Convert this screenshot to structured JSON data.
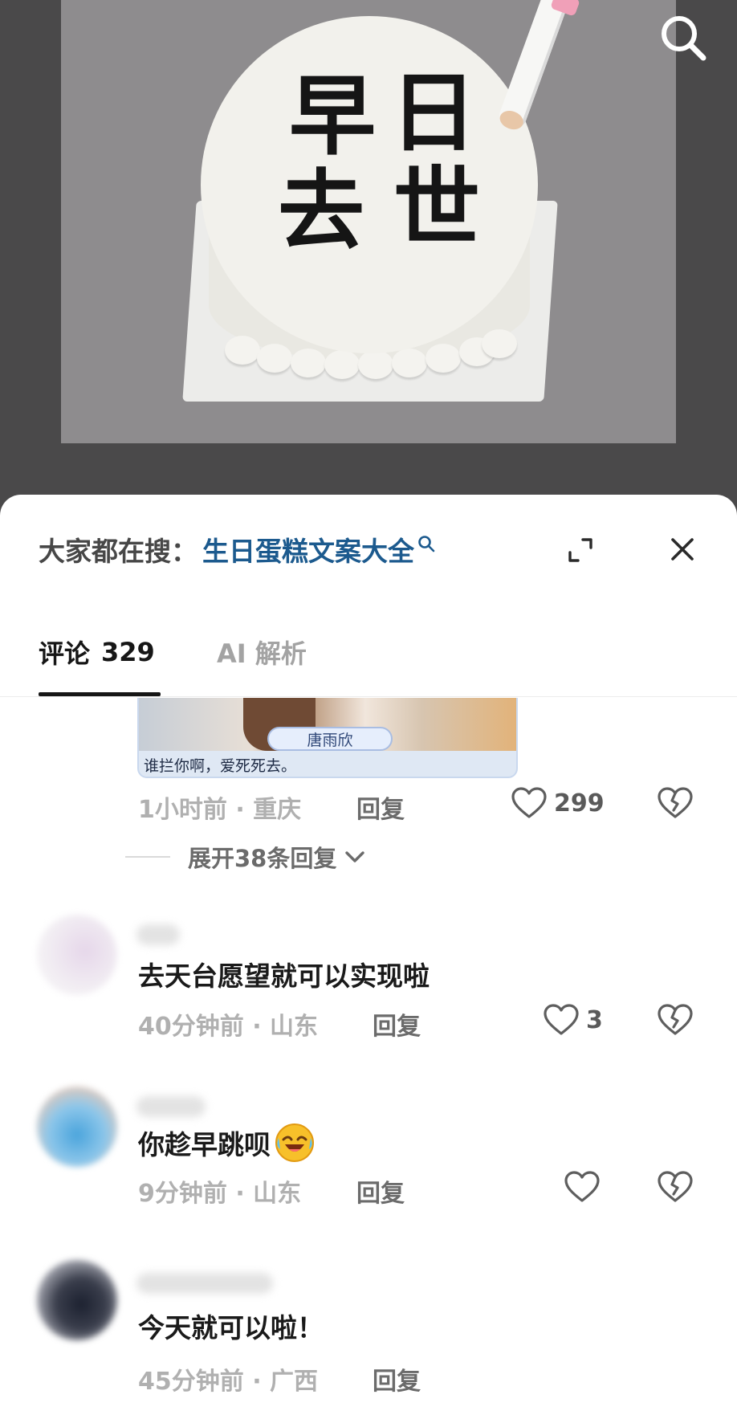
{
  "photo": {
    "cake_text": [
      "早",
      "日",
      "去",
      "世"
    ]
  },
  "trending": {
    "prefix": "大家都在搜：",
    "query": "生日蛋糕文案大全"
  },
  "tabs": {
    "comments_label": "评论",
    "comments_count": "329",
    "ai_label": "AI 解析"
  },
  "sticker": {
    "name_tag": "唐雨欣",
    "caption": "谁拦你啊，爱死死去。"
  },
  "comments": [
    {
      "text": "",
      "time": "1小时前 · 重庆",
      "reply": "回复",
      "likes": "299"
    },
    {
      "text": "去天台愿望就可以实现啦",
      "time": "40分钟前 · 山东",
      "reply": "回复",
      "likes": "3"
    },
    {
      "text": "你趁早跳呗",
      "time": "9分钟前 · 山东",
      "reply": "回复",
      "likes": ""
    },
    {
      "text": "今天就可以啦！",
      "time": "45分钟前 · 广西",
      "reply": "回复",
      "likes": ""
    }
  ],
  "expand_replies": "展开38条回复",
  "icons": {
    "search": "search-icon",
    "expand": "expand-icon",
    "close": "close-icon",
    "like": "heart-icon",
    "dislike": "broken-heart-icon",
    "emoji": "laughing-crying-emoji-icon"
  },
  "colors": {
    "query_blue": "#1c5a8e",
    "muted_gray": "#b0b0b0"
  }
}
